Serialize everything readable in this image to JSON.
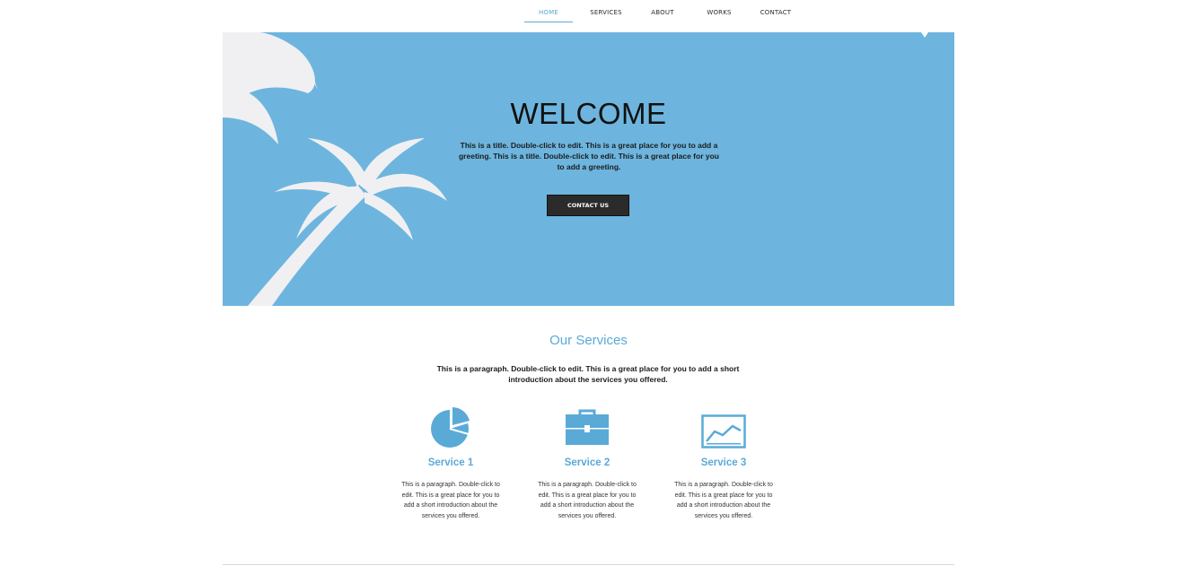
{
  "nav": {
    "items": [
      {
        "label": "HOME",
        "active": true
      },
      {
        "label": "SERVICES",
        "active": false
      },
      {
        "label": "ABOUT",
        "active": false
      },
      {
        "label": "WORKS",
        "active": false
      },
      {
        "label": "CONTACT",
        "active": false
      }
    ]
  },
  "hero": {
    "title": "WELCOME",
    "text": "This is a title. Double-click to edit. This is a great place for you to add a greeting. This is a title. Double-click to edit. This is a great place for you to add a greeting.",
    "button_label": "CONTACT US",
    "background_color": "#6db5de"
  },
  "services": {
    "title": "Our Services",
    "intro": "This is a paragraph. Double-click to edit. This is a great place for you to add a short introduction about the services you offered.",
    "items": [
      {
        "icon": "pie-chart-icon",
        "title": "Service 1",
        "text": "This is a paragraph. Double-click to edit. This is a great place for you to add a short introduction about the services you offered."
      },
      {
        "icon": "briefcase-icon",
        "title": "Service 2",
        "text": "This is a paragraph. Double-click to edit. This is a great place for you to add a short introduction about the services you offered."
      },
      {
        "icon": "line-chart-icon",
        "title": "Service 3",
        "text": "This is a paragraph. Double-click to edit. This is a great place for you to add a short introduction about the services you offered."
      }
    ]
  },
  "colors": {
    "accent": "#5aaad8",
    "button": "#2b2b2b"
  }
}
